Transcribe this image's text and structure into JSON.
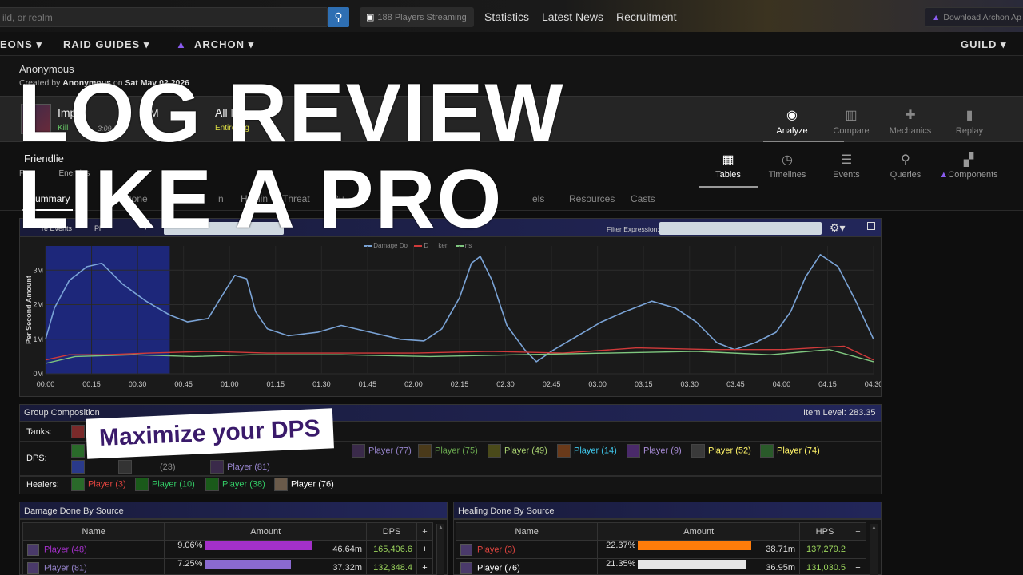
{
  "topbar": {
    "search_placeholder": "ild, or realm",
    "streaming": "188 Players Streaming",
    "links": [
      "Statistics",
      "Latest News",
      "Recruitment"
    ],
    "download": "Download Archon Ap"
  },
  "nav": {
    "items": [
      "EONS ▾",
      "RAID GUIDES ▾",
      "ARCHON ▾"
    ],
    "guild": "GUILD ▾"
  },
  "report": {
    "owner": "Anonymous",
    "created_prefix": "Created by ",
    "created_by": "Anonymous",
    "created_mid": " on ",
    "created_date": "Sat May 02 2026"
  },
  "fight": {
    "name": "Imp",
    "name_tail": "n M",
    "status": "Kill",
    "time": "3:09 PM",
    "phase": "All Phas",
    "phase_sub": "Entire Fig"
  },
  "fight_tabs": [
    {
      "label": "Analyze",
      "icon": "eye-icon",
      "glyph": "◉"
    },
    {
      "label": "Compare",
      "icon": "compare-icon",
      "glyph": "▥"
    },
    {
      "label": "Mechanics",
      "icon": "puzzle-icon",
      "glyph": "✚"
    },
    {
      "label": "Replay",
      "icon": "replay-icon",
      "glyph": "▮"
    }
  ],
  "view": {
    "title": "Friendlie",
    "sub1": "Fr",
    "sub2": "Enemies"
  },
  "view_tabs": [
    {
      "label": "Tables",
      "icon": "table-icon",
      "glyph": "▦"
    },
    {
      "label": "Timelines",
      "icon": "clock-icon",
      "glyph": "◷"
    },
    {
      "label": "Events",
      "icon": "list-icon",
      "glyph": "☰"
    },
    {
      "label": "Queries",
      "icon": "pin-icon",
      "glyph": "⚲"
    },
    {
      "label": "Components",
      "icon": "components-icon",
      "glyph": "▞"
    }
  ],
  "summary_tabs": [
    "Summary",
    "",
    "Done",
    "Da",
    "n",
    "Healin",
    "Threat",
    "Bu",
    "",
    "",
    "Pl",
    "els",
    "Resources",
    "Casts"
  ],
  "graph": {
    "left_label": "re Events",
    "mid_label": "Pl",
    "filter_label": "Filter Expression:",
    "legend": [
      "Damage Do",
      "D",
      "ken",
      "ns"
    ]
  },
  "chart_data": {
    "type": "line",
    "ylabel": "Per Second Amount",
    "y_ticks": [
      "0M",
      "1M",
      "2M",
      "3M"
    ],
    "ylim": [
      0,
      3.7
    ],
    "x_ticks": [
      "00:00",
      "00:15",
      "00:30",
      "00:45",
      "01:00",
      "01:15",
      "01:30",
      "01:45",
      "02:00",
      "02:15",
      "02:30",
      "02:45",
      "03:00",
      "03:15",
      "03:30",
      "03:45",
      "04:00",
      "04:15",
      "04:30"
    ],
    "xlim": [
      0,
      280
    ],
    "selection": [
      0,
      42
    ],
    "series": [
      {
        "color": "#7aa3d6",
        "values": [
          [
            0,
            1.0
          ],
          [
            3,
            1.9
          ],
          [
            8,
            2.7
          ],
          [
            14,
            3.1
          ],
          [
            19,
            3.2
          ],
          [
            26,
            2.6
          ],
          [
            34,
            2.1
          ],
          [
            42,
            1.7
          ],
          [
            48,
            1.5
          ],
          [
            55,
            1.6
          ],
          [
            60,
            2.3
          ],
          [
            64,
            2.85
          ],
          [
            68,
            2.75
          ],
          [
            71,
            1.8
          ],
          [
            75,
            1.3
          ],
          [
            82,
            1.1
          ],
          [
            92,
            1.2
          ],
          [
            100,
            1.4
          ],
          [
            110,
            1.2
          ],
          [
            120,
            1.0
          ],
          [
            128,
            0.95
          ],
          [
            134,
            1.3
          ],
          [
            140,
            2.2
          ],
          [
            144,
            3.2
          ],
          [
            147,
            3.4
          ],
          [
            151,
            2.7
          ],
          [
            156,
            1.4
          ],
          [
            162,
            0.7
          ],
          [
            166,
            0.35
          ],
          [
            172,
            0.7
          ],
          [
            180,
            1.1
          ],
          [
            188,
            1.5
          ],
          [
            196,
            1.8
          ],
          [
            205,
            2.1
          ],
          [
            213,
            1.9
          ],
          [
            220,
            1.5
          ],
          [
            227,
            0.9
          ],
          [
            233,
            0.7
          ],
          [
            240,
            0.9
          ],
          [
            247,
            1.2
          ],
          [
            252,
            1.8
          ],
          [
            257,
            2.8
          ],
          [
            262,
            3.45
          ],
          [
            268,
            3.1
          ],
          [
            274,
            2.1
          ],
          [
            280,
            1.0
          ]
        ]
      },
      {
        "color": "#d03a3a",
        "values": [
          [
            0,
            0.4
          ],
          [
            8,
            0.55
          ],
          [
            20,
            0.55
          ],
          [
            35,
            0.6
          ],
          [
            55,
            0.65
          ],
          [
            75,
            0.6
          ],
          [
            100,
            0.6
          ],
          [
            125,
            0.6
          ],
          [
            150,
            0.65
          ],
          [
            175,
            0.6
          ],
          [
            200,
            0.75
          ],
          [
            225,
            0.7
          ],
          [
            250,
            0.7
          ],
          [
            270,
            0.8
          ],
          [
            280,
            0.4
          ]
        ]
      },
      {
        "color": "#7fc77f",
        "values": [
          [
            0,
            0.3
          ],
          [
            10,
            0.5
          ],
          [
            30,
            0.55
          ],
          [
            50,
            0.5
          ],
          [
            70,
            0.55
          ],
          [
            100,
            0.55
          ],
          [
            130,
            0.5
          ],
          [
            160,
            0.55
          ],
          [
            190,
            0.6
          ],
          [
            220,
            0.65
          ],
          [
            245,
            0.55
          ],
          [
            265,
            0.7
          ],
          [
            280,
            0.35
          ]
        ]
      }
    ]
  },
  "group_comp": {
    "title": "Group Composition",
    "item_level_label": "Item Level:",
    "item_level": "283.35",
    "tanks_label": "Tanks:",
    "dps_label": "DPS:",
    "healers_label": "Healers:",
    "dps_row1": [
      {
        "name": "Player (77)",
        "color": "#9482c9",
        "sq": "#3a2a4a"
      },
      {
        "name": "Player (75)",
        "color": "#6aa84f",
        "sq": "#4a3a1a"
      },
      {
        "name": "Player (49)",
        "color": "#a9d271",
        "sq": "#4a4a1a"
      },
      {
        "name": "Player (14)",
        "color": "#3fc7eb",
        "sq": "#6a3a1a"
      },
      {
        "name": "Player (9)",
        "color": "#a78bd6",
        "sq": "#4a2a6a"
      },
      {
        "name": "Player (52)",
        "color": "#fff468",
        "sq": "#3a3a3a"
      },
      {
        "name": "Player (74)",
        "color": "#fff468",
        "sq": "#2a5a2a"
      }
    ],
    "dps_row2": [
      {
        "name": "(23)",
        "color": "#888"
      },
      {
        "name": "Player (81)",
        "color": "#9482c9"
      }
    ],
    "healers": [
      {
        "name": "Player (3)",
        "color": "#e0443f",
        "sq": "#2a6a2a"
      },
      {
        "name": "Player (10)",
        "color": "#33cc66",
        "sq": "#1a5a1a"
      },
      {
        "name": "Player (38)",
        "color": "#33cc66",
        "sq": "#1a5a1a"
      },
      {
        "name": "Player (76)",
        "color": "#ffffff",
        "sq": "#6a5a4a"
      }
    ]
  },
  "damage": {
    "title": "Damage Done By Source",
    "cols": [
      "Name",
      "Amount",
      "DPS",
      "+"
    ],
    "rows": [
      {
        "name": "Player (48)",
        "pct": "9.06%",
        "bar": 0.906,
        "barcolor": "#a330c9",
        "amount": "46.64m",
        "dps": "165,406.6",
        "name_color": "#a330c9"
      },
      {
        "name": "Player (81)",
        "pct": "7.25%",
        "bar": 0.725,
        "barcolor": "#8a6ad0",
        "amount": "37.32m",
        "dps": "132,348.4",
        "name_color": "#9482c9"
      }
    ]
  },
  "healing": {
    "title": "Healing Done By Source",
    "cols": [
      "Name",
      "Amount",
      "HPS",
      "+"
    ],
    "rows": [
      {
        "name": "Player (3)",
        "pct": "22.37%",
        "bar": 0.96,
        "barcolor": "#ff7c0a",
        "amount": "38.71m",
        "hps": "137,279.2",
        "name_color": "#e0443f"
      },
      {
        "name": "Player (76)",
        "pct": "21.35%",
        "bar": 0.92,
        "barcolor": "#e6e6e6",
        "amount": "36.95m",
        "hps": "131,030.5",
        "name_color": "#ffffff"
      }
    ]
  },
  "overlay": {
    "line1": "LOG REVIEW",
    "line2": "LIKE A PRO",
    "badge": "Maximize your DPS"
  }
}
